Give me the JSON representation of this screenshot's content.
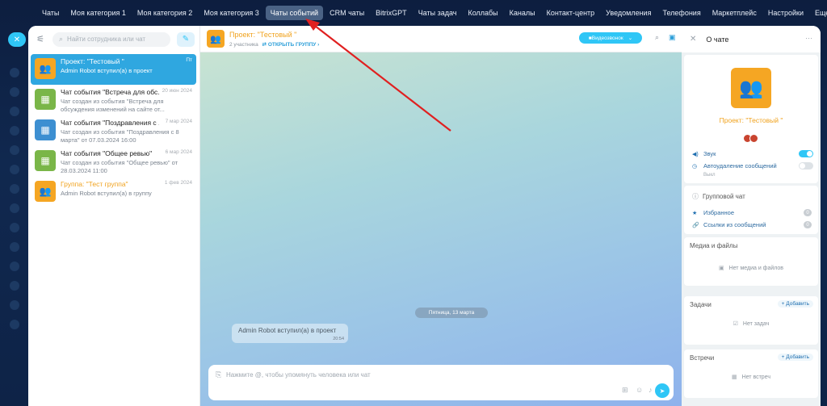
{
  "topnav": {
    "items": [
      "Чаты",
      "Моя категория 1",
      "Моя категория 2",
      "Моя категория 3",
      "Чаты событий",
      "CRM чаты",
      "BitrixGPT",
      "Чаты задач",
      "Коллабы",
      "Каналы",
      "Контакт-центр",
      "Уведомления",
      "Телефония",
      "Маркетплейс",
      "Настройки",
      "Еще ⌄"
    ],
    "active_index": 4
  },
  "chatlist": {
    "search_placeholder": "Найти сотрудника или чат",
    "items": [
      {
        "title": "Проект: \"Тестовый \"",
        "date": "Пт",
        "message": "Admin Robot вступил(а) в проект",
        "icon": "group-icon",
        "color": "#f5a623",
        "active": true,
        "orange": false
      },
      {
        "title": "Чат события \"Встреча для обс...",
        "date": "20 июн 2024",
        "message": "Чат создан из события \"Встреча для обсуждения изменений на сайте от...",
        "icon": "calendar-icon",
        "color": "#7ab648",
        "active": false,
        "orange": false
      },
      {
        "title": "Чат события \"Поздравления с ...",
        "date": "7 мар 2024",
        "message": "Чат создан из события \"Поздравления с 8 марта\" от 07.03.2024 16:00",
        "icon": "calendar-icon",
        "color": "#3d8fd1",
        "active": false,
        "orange": false
      },
      {
        "title": "Чат события \"Общее ревью\"",
        "date": "6 мар 2024",
        "message": "Чат создан из события \"Общее ревью\" от 28.03.2024 11:00",
        "icon": "calendar-icon",
        "color": "#7ab648",
        "active": false,
        "orange": false
      },
      {
        "title": "Группа: \"Тест группа\"",
        "date": "1 фев 2024",
        "message": "Admin Robot вступил(а) в группу",
        "icon": "group-icon",
        "color": "#f5a623",
        "active": false,
        "orange": true
      }
    ]
  },
  "chat": {
    "title": "Проект: \"Тестовый \"",
    "participants": "2 участника",
    "open_group": "ОТКРЫТЬ ГРУППУ",
    "video_label": "Видеозвонок",
    "date_divider": "Пятница, 13 марта",
    "system_message": "Admin Robot вступил(а) в проект",
    "system_time": "20:54",
    "composer_placeholder": "Нажмите @, чтобы упомянуть человека или чат"
  },
  "panel": {
    "title": "О чате",
    "project_name": "Проект: \"Тестовый \"",
    "sound_label": "Звук",
    "sound_on": true,
    "autodelete_label": "Автоудаление сообщений",
    "autodelete_note": "Выкл",
    "autodelete_on": false,
    "chat_type": "Групповой чат",
    "favorites_label": "Избранное",
    "favorites_count": "0",
    "links_label": "Ссылки из сообщений",
    "links_count": "0",
    "media_title": "Медиа и файлы",
    "media_empty": "Нет медиа и файлов",
    "tasks_title": "Задачи",
    "tasks_add": "+ Добавить",
    "tasks_empty": "Нет задач",
    "meetings_title": "Встречи",
    "meetings_add": "+ Добавить",
    "meetings_empty": "Нет встреч"
  },
  "colors": {
    "accent": "#2fc6f6",
    "project": "#f5a623",
    "annotation_arrow": "#e02020"
  }
}
